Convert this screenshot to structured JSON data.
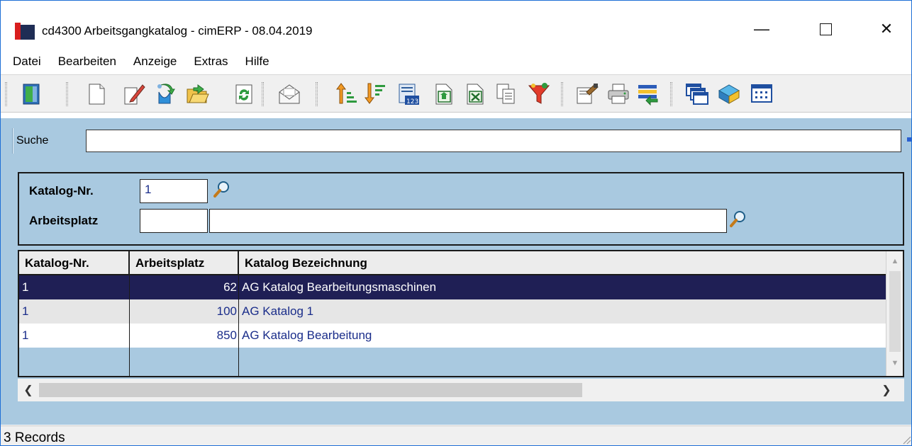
{
  "window": {
    "title": "cd4300 Arbeitsgangkatalog - cimERP - 08.04.2019",
    "minimize_glyph": "—",
    "close_glyph": "✕"
  },
  "menu": [
    "Datei",
    "Bearbeiten",
    "Anzeige",
    "Extras",
    "Hilfe"
  ],
  "toolbar": {
    "icons": [
      "exit-icon",
      "new-document-icon",
      "edit-icon",
      "save-icon",
      "open-folder-icon",
      "refresh-icon",
      "mail-icon",
      "sort-ascending-icon",
      "sort-descending-icon",
      "number-format-icon",
      "export-icon",
      "excel-icon",
      "copy-icon",
      "filter-icon",
      "properties-icon",
      "print-icon",
      "list-transfer-icon",
      "windows-icon",
      "help-book-icon",
      "grid-view-icon"
    ]
  },
  "search": {
    "label": "Suche",
    "value": ""
  },
  "filter": {
    "katalog_label": "Katalog-Nr.",
    "katalog_value": "1",
    "arbeitsplatz_label": "Arbeitsplatz",
    "arbeitsplatz_value": "",
    "arbeitsplatz_name": ""
  },
  "grid": {
    "columns": [
      "Katalog-Nr.",
      "Arbeitsplatz",
      "Katalog Bezeichnung"
    ],
    "rows": [
      {
        "katalog": "1",
        "arbeitsplatz": "62",
        "bezeichnung": "AG Katalog Bearbeitungsmaschinen",
        "selected": true
      },
      {
        "katalog": "1",
        "arbeitsplatz": "100",
        "bezeichnung": "AG Katalog 1",
        "selected": false
      },
      {
        "katalog": "1",
        "arbeitsplatz": "850",
        "bezeichnung": "AG Katalog Bearbeitung",
        "selected": false
      }
    ]
  },
  "status": {
    "text": "3 Records"
  },
  "colors": {
    "panel_background": "#a9c9e0",
    "selected_row": "#1f1f55",
    "value_text": "#1a2d8a"
  }
}
